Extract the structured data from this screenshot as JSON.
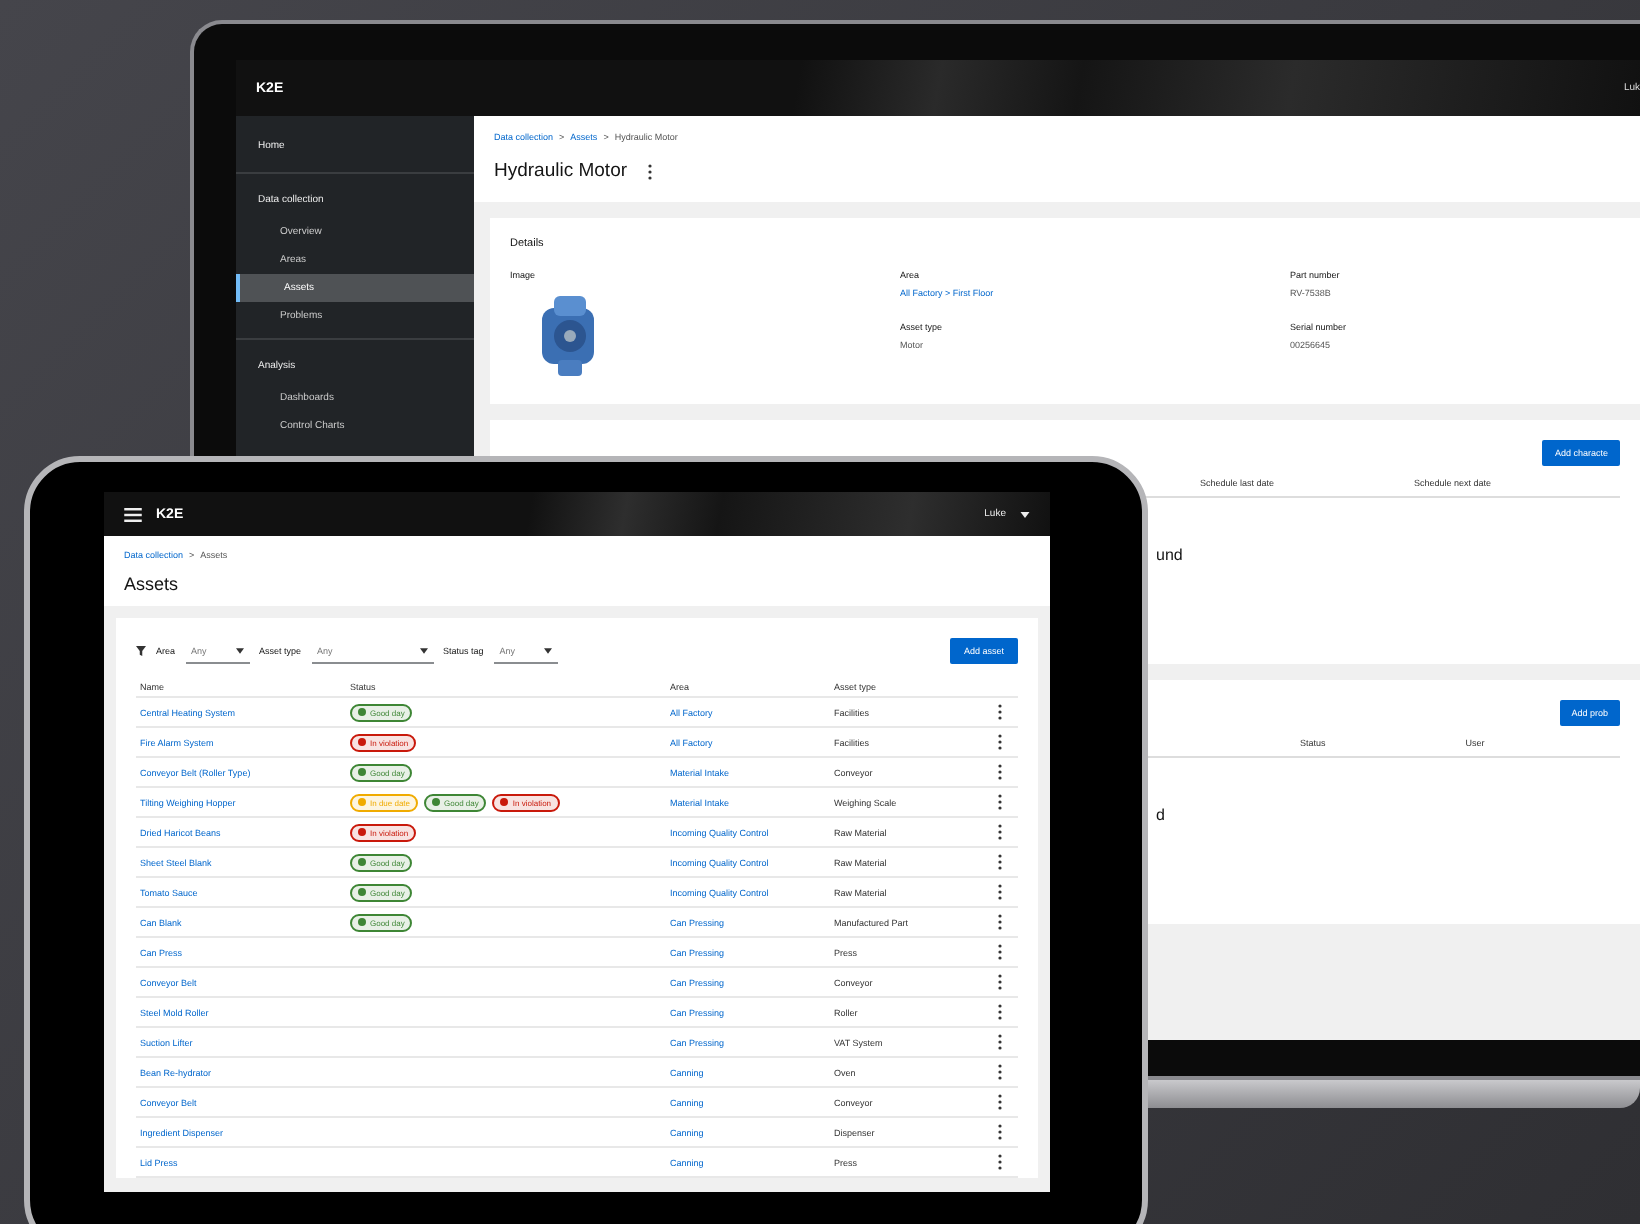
{
  "laptop": {
    "topbar": {
      "logo": "K2E",
      "user": "Luk"
    },
    "sidebar": [
      {
        "label": "Home",
        "kind": "section"
      },
      {
        "label": "Data collection",
        "kind": "section"
      },
      {
        "label": "Overview",
        "kind": "item",
        "selected": false
      },
      {
        "label": "Areas",
        "kind": "item",
        "selected": false
      },
      {
        "label": "Assets",
        "kind": "item",
        "selected": true
      },
      {
        "label": "Problems",
        "kind": "item",
        "selected": false
      },
      {
        "label": "Analysis",
        "kind": "section"
      },
      {
        "label": "Dashboards",
        "kind": "item",
        "selected": false
      },
      {
        "label": "Control Charts",
        "kind": "item",
        "selected": false
      }
    ],
    "breadcrumb": [
      {
        "kind": "link",
        "label": "Data collection"
      },
      {
        "kind": "separator",
        "label": ">"
      },
      {
        "kind": "link",
        "label": "Assets"
      },
      {
        "kind": "separator",
        "label": ">"
      },
      {
        "kind": "current",
        "label": "Hydraulic Motor"
      }
    ],
    "title": "Hydraulic Motor",
    "details": {
      "title": "Details",
      "image_label": "Image",
      "fields": [
        {
          "label": "Area",
          "value": "All Factory > First Floor",
          "kind": "link"
        },
        {
          "label": "Part number",
          "value": "RV-7538B",
          "kind": "text"
        },
        {
          "label": "Asset type",
          "value": "Motor",
          "kind": "text"
        },
        {
          "label": "Serial number",
          "value": "00256645",
          "kind": "text"
        }
      ]
    },
    "characteristics": {
      "button": "Add characte",
      "columns": [
        "Schedule last date",
        "Schedule next date"
      ],
      "empty": "und"
    },
    "problems": {
      "button": "Add prob",
      "columns": [
        "Status",
        "User"
      ],
      "empty": "d"
    }
  },
  "tablet": {
    "topbar": {
      "logo": "K2E",
      "user": "Luke"
    },
    "breadcrumb": [
      {
        "kind": "link",
        "label": "Data collection"
      },
      {
        "kind": "separator",
        "label": ">"
      },
      {
        "kind": "current",
        "label": "Assets"
      }
    ],
    "title": "Assets",
    "filters": [
      {
        "label": "Area",
        "value": "Any"
      },
      {
        "label": "Asset type",
        "value": "Any"
      },
      {
        "label": "Status tag",
        "value": "Any"
      }
    ],
    "add_button": "Add asset",
    "columns": [
      "Name",
      "Status",
      "Area",
      "Asset type"
    ],
    "rows": [
      {
        "name": "Central Heating System",
        "tags": [
          {
            "label": "Good day",
            "color": "#3e8635"
          }
        ],
        "area": "All Factory",
        "type": "Facilities"
      },
      {
        "name": "Fire Alarm System",
        "tags": [
          {
            "label": "In violation",
            "color": "#c9190b"
          }
        ],
        "area": "All Factory",
        "type": "Facilities"
      },
      {
        "name": "Conveyor Belt (Roller Type)",
        "tags": [
          {
            "label": "Good day",
            "color": "#3e8635"
          }
        ],
        "area": "Material Intake",
        "type": "Conveyor"
      },
      {
        "name": "Tilting Weighing Hopper",
        "tags": [
          {
            "label": "In due date",
            "color": "#f0ab00"
          },
          {
            "label": "Good day",
            "color": "#3e8635"
          },
          {
            "label": "In violation",
            "color": "#c9190b"
          }
        ],
        "area": "Material Intake",
        "type": "Weighing Scale"
      },
      {
        "name": "Dried Haricot Beans",
        "tags": [
          {
            "label": "In violation",
            "color": "#c9190b"
          }
        ],
        "area": "Incoming Quality Control",
        "type": "Raw Material"
      },
      {
        "name": "Sheet Steel Blank",
        "tags": [
          {
            "label": "Good day",
            "color": "#3e8635"
          }
        ],
        "area": "Incoming Quality Control",
        "type": "Raw Material"
      },
      {
        "name": "Tomato Sauce",
        "tags": [
          {
            "label": "Good day",
            "color": "#3e8635"
          }
        ],
        "area": "Incoming Quality Control",
        "type": "Raw Material"
      },
      {
        "name": "Can Blank",
        "tags": [
          {
            "label": "Good day",
            "color": "#3e8635"
          }
        ],
        "area": "Can Pressing",
        "type": "Manufactured Part"
      },
      {
        "name": "Can Press",
        "tags": [],
        "area": "Can Pressing",
        "type": "Press"
      },
      {
        "name": "Conveyor Belt",
        "tags": [],
        "area": "Can Pressing",
        "type": "Conveyor"
      },
      {
        "name": "Steel Mold Roller",
        "tags": [],
        "area": "Can Pressing",
        "type": "Roller"
      },
      {
        "name": "Suction Lifter",
        "tags": [],
        "area": "Can Pressing",
        "type": "VAT System"
      },
      {
        "name": "Bean Re-hydrator",
        "tags": [],
        "area": "Canning",
        "type": "Oven"
      },
      {
        "name": "Conveyor Belt",
        "tags": [],
        "area": "Canning",
        "type": "Conveyor"
      },
      {
        "name": "Ingredient Dispenser",
        "tags": [],
        "area": "Canning",
        "type": "Dispenser"
      },
      {
        "name": "Lid Press",
        "tags": [],
        "area": "Canning",
        "type": "Press"
      }
    ]
  }
}
